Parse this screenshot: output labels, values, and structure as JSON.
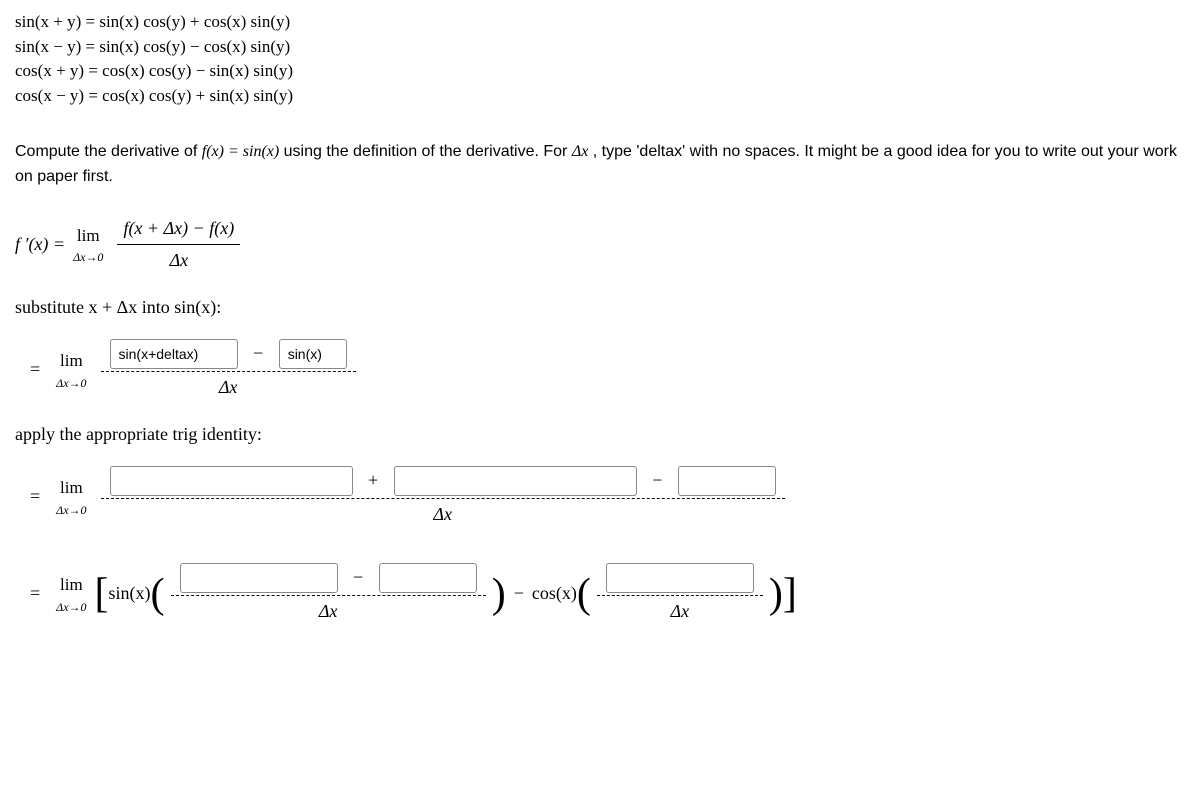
{
  "identities": {
    "line1": "sin(x + y) = sin(x) cos(y) + cos(x) sin(y)",
    "line2": "sin(x − y) = sin(x) cos(y) − cos(x) sin(y)",
    "line3": "cos(x + y) = cos(x) cos(y) − sin(x) sin(y)",
    "line4": "cos(x − y) = cos(x) cos(y) + sin(x) sin(y)"
  },
  "instruction": {
    "prefix": "Compute the derivative of ",
    "func": "f(x) = sin(x)",
    "mid": " using the definition of the derivative. For ",
    "delta": "Δx",
    "suffix": ", type 'deltax' with no spaces. It might be a good idea for you to write out your work on paper first."
  },
  "definition": {
    "lhs": "f ′(x) = ",
    "lim": "lim",
    "limsub": "Δx→0",
    "num": "f(x + Δx) − f(x)",
    "den": "Δx"
  },
  "step1": {
    "text": "substitute x + Δx into sin(x):",
    "input1": "sin(x+deltax)",
    "input2": "sin(x)",
    "minus": "−",
    "den": "Δx"
  },
  "step2": {
    "text": "apply the appropriate trig identity:",
    "plus": "+",
    "minus": "−",
    "den": "Δx"
  },
  "step3": {
    "sin": "sin(x)",
    "cos": "cos(x)",
    "minus": "−",
    "den": "Δx"
  },
  "common": {
    "eq": "=",
    "lim": "lim",
    "limsub": "Δx→0"
  }
}
